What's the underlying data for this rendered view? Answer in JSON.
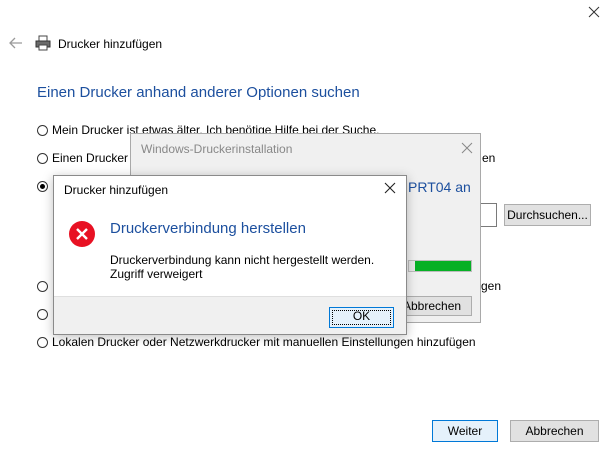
{
  "window": {
    "close_icon": "close-icon",
    "back_icon": "back-arrow-icon",
    "printer_icon": "printer-icon",
    "title": "Drucker hinzufügen"
  },
  "main": {
    "heading": "Einen Drucker anhand anderer Optionen suchen",
    "options": [
      {
        "label": "Mein Drucker ist etwas älter. Ich benötige Hilfe bei der Suche.",
        "checked": false
      },
      {
        "label": "Einen Drucker",
        "tail": "en",
        "checked": false
      },
      {
        "label": "",
        "checked": true
      },
      {
        "label": "",
        "tail": "gen",
        "checked": false
      },
      {
        "label": "",
        "checked": false
      },
      {
        "label": "Lokalen Drucker oder Netzwerkdrucker mit manuellen Einstellungen hinzufügen",
        "checked": false
      }
    ],
    "browse_label": "Durchsuchen...",
    "next_label": "Weiter",
    "cancel_label": "Abbrechen"
  },
  "installer": {
    "title": "Windows-Druckerinstallation",
    "printer_text": "PRT04 an",
    "progress_percent": 90,
    "cancel_label": "Abbrechen",
    "progress_color": "#06b025"
  },
  "error_dialog": {
    "title": "Drucker hinzufügen",
    "icon": "error-icon",
    "heading": "Druckerverbindung herstellen",
    "message_line1": "Druckerverbindung kann nicht hergestellt werden.",
    "message_line2": "Zugriff verweigert",
    "ok_label": "OK",
    "error_color": "#e81123"
  },
  "colors": {
    "accent": "#0078d7",
    "heading": "#1c4f9e",
    "dialog_gray": "#f0f0f0"
  }
}
